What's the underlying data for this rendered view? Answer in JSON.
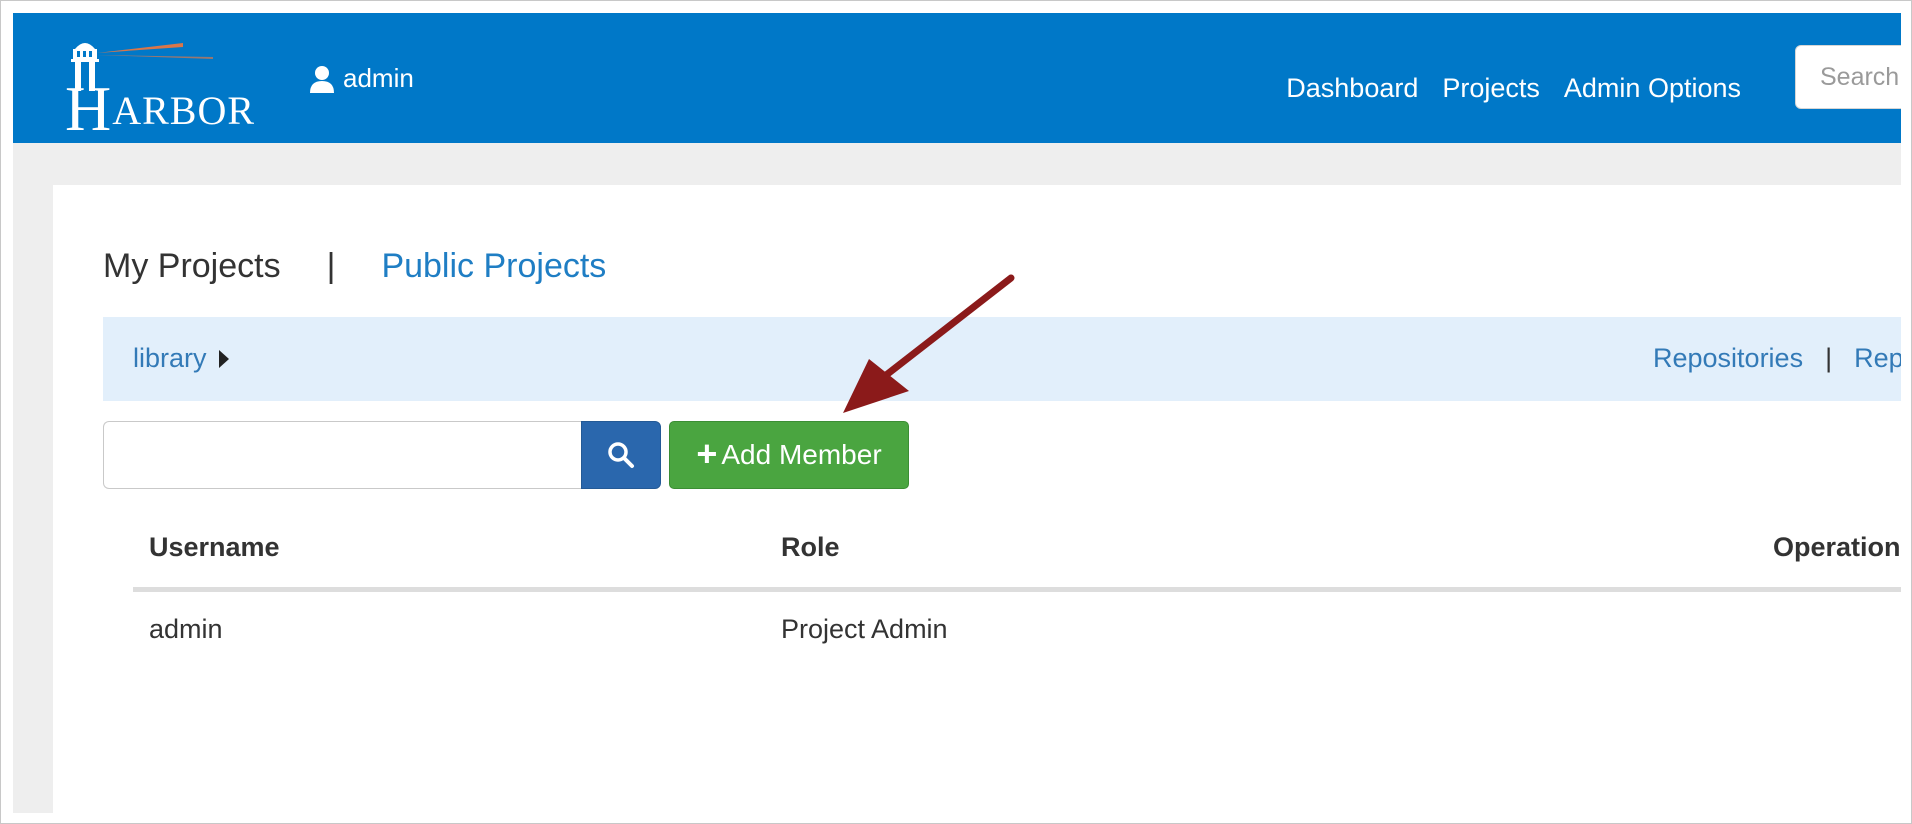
{
  "navbar": {
    "logo_text_cap": "H",
    "logo_text_rest": "ARBOR",
    "user_name": "admin",
    "links": [
      "Dashboard",
      "Projects",
      "Admin Options"
    ],
    "search_placeholder": "Search"
  },
  "tabs": {
    "active": "My Projects",
    "separator": "|",
    "other": "Public Projects"
  },
  "breadcrumb": {
    "project": "library",
    "right_links": [
      "Repositories",
      "Replication"
    ],
    "separator": "|"
  },
  "member_search": {
    "value": "",
    "add_button_label": "Add Member"
  },
  "table": {
    "headers": [
      "Username",
      "Role",
      "Operation"
    ],
    "rows": [
      {
        "username": "admin",
        "role": "Project Admin",
        "operation": ""
      }
    ]
  },
  "colors": {
    "navbar": "#0078c8",
    "link": "#337ab7",
    "add_button": "#4aa540",
    "search_button": "#2a67ad",
    "annotation_arrow": "#8b1a1a"
  }
}
